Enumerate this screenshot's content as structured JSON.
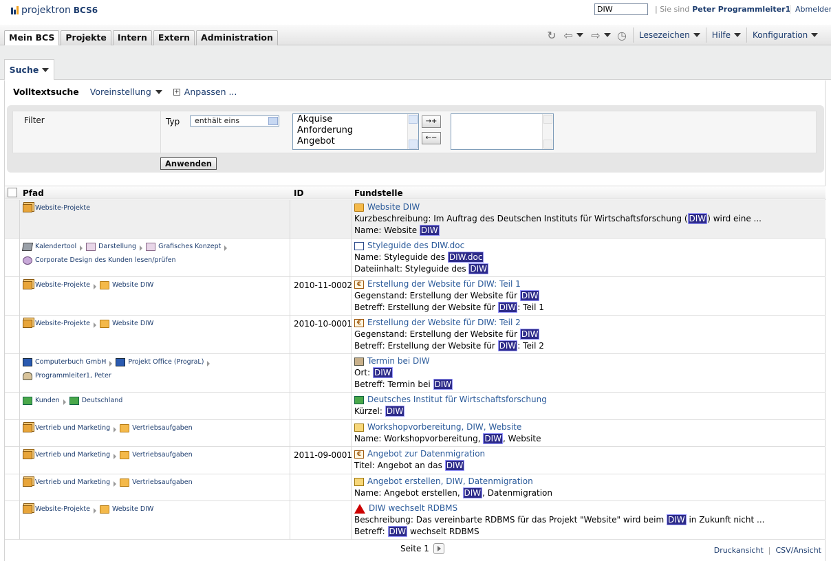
{
  "app": {
    "logo_text": "projektron",
    "logo_suffix": "BCS6"
  },
  "header": {
    "search_value": "DIW",
    "signed_in_label": "| Sie sind",
    "user_name": "Peter Programmleiter1",
    "logout_label": "Abmelden"
  },
  "nav": {
    "tabs": [
      {
        "label": "Mein BCS",
        "active": true
      },
      {
        "label": "Projekte"
      },
      {
        "label": "Intern"
      },
      {
        "label": "Extern"
      },
      {
        "label": "Administration"
      }
    ],
    "menus": {
      "bookmarks": "Lesezeichen",
      "help": "Hilfe",
      "config": "Konfiguration"
    }
  },
  "subnav": {
    "search_tab": "Suche"
  },
  "mode": {
    "current": "Volltextsuche",
    "preset": "Voreinstellung",
    "customize": "Anpassen ..."
  },
  "filter": {
    "label": "Filter",
    "type_label": "Typ",
    "type_select": "enthält eins",
    "available": [
      "Akquise",
      "Anforderung",
      "Angebot"
    ],
    "add_button": "→+",
    "remove_button": "←−",
    "apply_button": "Anwenden"
  },
  "table": {
    "columns": {
      "path": "Pfad",
      "id": "ID",
      "hit": "Fundstelle"
    },
    "rows": [
      {
        "path": [
          {
            "icon": "folder-stack-icon",
            "text": "Website-Projekte"
          }
        ],
        "id": "",
        "title_icon": "folder-icon",
        "title": "Website DIW",
        "lines": [
          [
            "Kurzbeschreibung: Im Auftrag des Deutschen Instituts für Wirtschaftsforschung (",
            "DIW",
            ") wird eine ..."
          ],
          [
            "Name: Website ",
            "DIW",
            ""
          ]
        ]
      },
      {
        "path": [
          {
            "icon": "calendar-icon",
            "text": "Kalendertool"
          },
          {
            "icon": "list-icon",
            "text": "Darstellung"
          },
          {
            "icon": "list-icon",
            "text": "Grafisches Konzept"
          },
          {
            "icon": "task-icon",
            "text": "Corporate Design des Kunden lesen/prüfen"
          }
        ],
        "id": "",
        "title_icon": "word-doc-icon",
        "title": "Styleguide des DIW.doc",
        "lines": [
          [
            "Name: Styleguide des ",
            "DIW.doc",
            ""
          ],
          [
            "Dateiinhalt: Styleguide des ",
            "DIW",
            ""
          ]
        ]
      },
      {
        "path": [
          {
            "icon": "folder-stack-icon",
            "text": "Website-Projekte"
          },
          {
            "icon": "folder-icon",
            "text": "Website DIW"
          }
        ],
        "id": "2010-11-0002",
        "title_icon": "euro-icon",
        "title": "Erstellung der Website für DIW: Teil 1",
        "lines": [
          [
            "Gegenstand: Erstellung der Website für ",
            "DIW",
            ""
          ],
          [
            "Betreff: Erstellung der Website für ",
            "DIW",
            ": Teil 1"
          ]
        ]
      },
      {
        "path": [
          {
            "icon": "folder-stack-icon",
            "text": "Website-Projekte"
          },
          {
            "icon": "folder-icon",
            "text": "Website DIW"
          }
        ],
        "id": "2010-10-0001",
        "title_icon": "euro-icon",
        "title": "Erstellung der Website für DIW: Teil 2",
        "lines": [
          [
            "Gegenstand: Erstellung der Website für ",
            "DIW",
            ""
          ],
          [
            "Betreff: Erstellung der Website für ",
            "DIW",
            ": Teil 2"
          ]
        ]
      },
      {
        "path": [
          {
            "icon": "building-icon",
            "text": "Computerbuch GmbH"
          },
          {
            "icon": "office-icon",
            "text": "Projekt Office (PrograL)"
          },
          {
            "icon": "person-icon",
            "text": "Programmleiter1, Peter"
          }
        ],
        "id": "",
        "title_icon": "appointment-icon",
        "title": "Termin bei DIW",
        "lines": [
          [
            "Ort: ",
            "DIW",
            ""
          ],
          [
            "Betreff: Termin bei ",
            "DIW",
            ""
          ]
        ]
      },
      {
        "path": [
          {
            "icon": "customer-building-icon",
            "text": "Kunden"
          },
          {
            "icon": "customer-building-icon",
            "text": "Deutschland"
          }
        ],
        "id": "",
        "title_icon": "customer-building-icon",
        "title": "Deutsches Institut für Wirtschaftsforschung",
        "lines": [
          [
            "Kürzel: ",
            "DIW",
            ""
          ]
        ]
      },
      {
        "path": [
          {
            "icon": "folder-stack-icon",
            "text": "Vertrieb und Marketing"
          },
          {
            "icon": "folder-icon",
            "text": "Vertriebsaufgaben"
          }
        ],
        "id": "",
        "title_icon": "note-icon",
        "title": "Workshopvorbereitung, DIW, Website",
        "lines": [
          [
            "Name: Workshopvorbereitung, ",
            "DIW",
            ", Website"
          ]
        ]
      },
      {
        "path": [
          {
            "icon": "folder-stack-icon",
            "text": "Vertrieb und Marketing"
          },
          {
            "icon": "folder-icon",
            "text": "Vertriebsaufgaben"
          }
        ],
        "id": "2011-09-0001",
        "title_icon": "euro-icon",
        "title": "Angebot zur Datenmigration",
        "lines": [
          [
            "Titel: Angebot an das ",
            "DIW",
            ""
          ]
        ]
      },
      {
        "path": [
          {
            "icon": "folder-stack-icon",
            "text": "Vertrieb und Marketing"
          },
          {
            "icon": "folder-icon",
            "text": "Vertriebsaufgaben"
          }
        ],
        "id": "",
        "title_icon": "note-icon",
        "title": "Angebot erstellen, DIW, Datenmigration",
        "lines": [
          [
            "Name: Angebot erstellen, ",
            "DIW",
            ", Datenmigration"
          ]
        ]
      },
      {
        "path": [
          {
            "icon": "folder-stack-icon",
            "text": "Website-Projekte"
          },
          {
            "icon": "folder-icon",
            "text": "Website DIW"
          }
        ],
        "id": "",
        "title_icon": "warning-icon",
        "title": "DIW wechselt RDBMS",
        "lines": [
          [
            "Beschreibung: Das vereinbarte RDBMS für das Projekt \"Website\" wird beim ",
            "DIW",
            " in Zukunft nicht ..."
          ],
          [
            "Betreff: ",
            "DIW",
            " wechselt RDBMS"
          ]
        ]
      }
    ]
  },
  "footer": {
    "page_label": "Seite 1",
    "print_view": "Druckansicht",
    "csv_view": "CSV/Ansicht"
  },
  "colors": {
    "link": "#1c3c6e",
    "highlight_bg": "#2d2b8a"
  }
}
